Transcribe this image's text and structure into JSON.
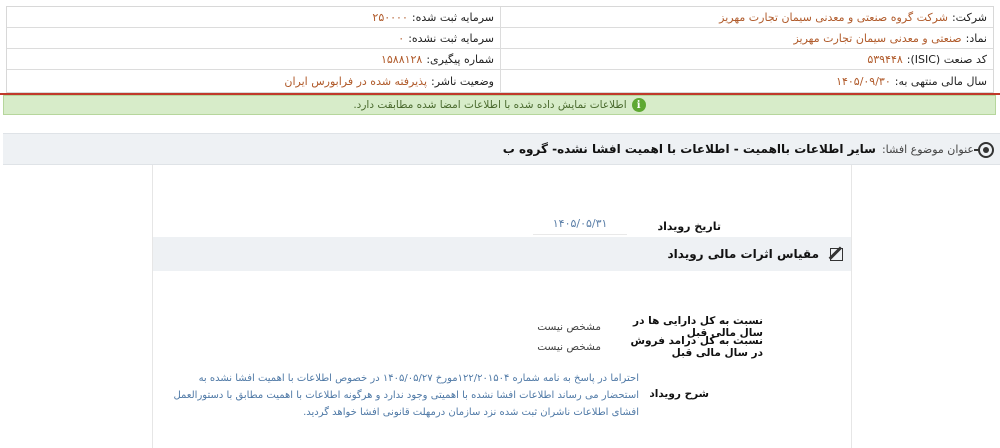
{
  "company_info": {
    "company_label": "شرکت:",
    "company_value": "شرکت گروه صنعتی و معدنی سیمان تجارت مهریز",
    "registered_capital_label": "سرمایه ثبت شده:",
    "registered_capital_value": "۲۵۰۰۰۰",
    "symbol_label": "نماد:",
    "symbol_value": "صنعتی و معدنی سیمان تجارت مهریز",
    "unregistered_capital_label": "سرمایه ثبت نشده:",
    "unregistered_capital_value": "۰",
    "isic_label": "کد صنعت (ISIC):",
    "isic_value": "۵۳۹۴۴۸",
    "tracking_label": "شماره پیگیری:",
    "tracking_value": "۱۵۸۸۱۲۸",
    "fiscal_year_label": "سال مالی منتهی به:",
    "fiscal_year_value": "۱۴۰۵/۰۹/۳۰",
    "publisher_status_label": "وضعیت ناشر:",
    "publisher_status_value": "پذیرفته شده در فرابورس ایران"
  },
  "notice": {
    "text": "اطلاعات نمایش داده شده با اطلاعات امضا شده مطابقت دارد.",
    "icon": "info-icon",
    "color": "#5ea832"
  },
  "subject": {
    "label": "عنوان موضوع افشا:",
    "value": "سایر اطلاعات بااهمیت - اطلاعات با اهمیت افشا نشده- گروه ب"
  },
  "event": {
    "date_label": "تاریخ رویداد",
    "date_value": "۱۴۰۵/۰۵/۳۱"
  },
  "financial_impact": {
    "title": "مقیاس اثرات مالی رویداد",
    "rows": [
      {
        "label": "نسبت به کل دارایی ها در سال مالی قبل",
        "value": "مشخص نیست"
      },
      {
        "label": "نسبت به کل درامد فروش در سال مالی قبل",
        "value": "مشخص نیست"
      }
    ]
  },
  "description": {
    "label": "شرح رویداد",
    "text": "احتراما در پاسخ به نامه شماره ۱۲۲/۲۰۱۵۰۴مورخ ۱۴۰۵/۰۵/۲۷ در خصوص اطلاعات با اهمیت افشا نشده به استحضار می رساند اطلاعات افشا نشده با اهمیتی وجود ندارد و هرگونه اطلاعات با اهمیت مطابق با دستورالعمل افشای اطلاعات ناشران ثبت شده نزد سازمان درمهلت قانونی افشا خواهد گردید."
  },
  "colors": {
    "value_text": "#b05a2a",
    "red_line": "#c0392b",
    "notice_bg": "#d7ecc9",
    "link_blue": "#4f79a6"
  }
}
